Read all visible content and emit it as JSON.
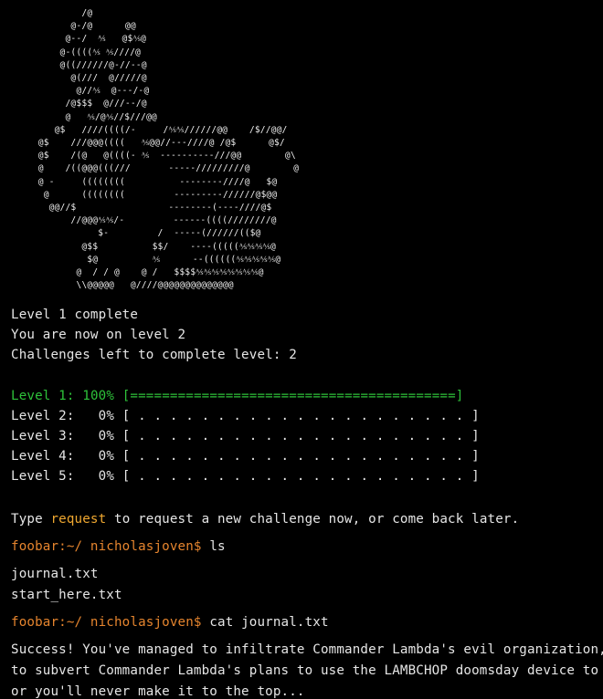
{
  "ascii_art": [
    "          /@",
    "        @-/@      @@",
    "       @--/  ⅍   @$⅍@",
    "      @-((((⅍ ⅍////@",
    "      @((//////@-//--@",
    "        @(///  @/////@",
    "         @//⅍  @---/-@",
    "       /@$$$  @///--/@",
    "       @   ⅍/@⅍//$///@@",
    "     @$   ////((((/-     /⅍⅍//////@@    /$//@@/",
    "  @$    ///@@@((((   ⅍@@//---////@ /@$      @$/",
    "  @$    /(@   @((((- ⅍  ----------///@@        @\\",
    "  @    /((@@@(((///       -----/////////@        @",
    "  @ -     ((((((((          --------////@   $@",
    "   @      ((((((((         ---------//////@$@@",
    "    @@//$                 --------(----////@$",
    "        //@@@⅍⅍/-         ------((((////////@",
    "             $-         /  -----(//////(($@",
    "          @$$          $$/    ----(((((⅍⅍⅍⅍@",
    "           $@          ⅍      --((((((⅍⅍⅍⅍⅍@",
    "         @  / / @    @ /   $$$$⅍⅍⅍⅍⅍⅍⅍⅍@",
    "         \\\\@@@@@   @////@@@@@@@@@@@@@@"
  ],
  "messages": {
    "level_complete": "Level 1 complete",
    "current_level": "You are now on level 2",
    "challenges_left": "Challenges left to complete level: 2"
  },
  "progress": [
    {
      "label": "Level 1:",
      "percent": "100%",
      "bar": "[=========================================]",
      "value": 1.0
    },
    {
      "label": "Level 2:",
      "percent": "0%",
      "bar": "[ . . . . . . . . . . . . . . . . . . . . . ]",
      "value": 0.0
    },
    {
      "label": "Level 3:",
      "percent": "0%",
      "bar": "[ . . . . . . . . . . . . . . . . . . . . . ]",
      "value": 0.0
    },
    {
      "label": "Level 4:",
      "percent": "0%",
      "bar": "[ . . . . . . . . . . . . . . . . . . . . . ]",
      "value": 0.0
    },
    {
      "label": "Level 5:",
      "percent": "0%",
      "bar": "[ . . . . . . . . . . . . . . . . . . . . . ]",
      "value": 0.0
    }
  ],
  "request_prompt": {
    "before": "Type ",
    "keyword": "request",
    "after": " to request a new challenge now, or come back later."
  },
  "commands": [
    {
      "prompt": "foobar:~/ nicholasjoven$",
      "command": "ls"
    },
    {
      "prompt": "foobar:~/ nicholasjoven$",
      "command": "cat journal.txt"
    }
  ],
  "ls_output": [
    "journal.txt",
    "start_here.txt"
  ],
  "journal": [
    "Success! You've managed to infiltrate Commander Lambda's evil organization,",
    "to subvert Commander Lambda's plans to use the LAMBCHOP doomsday device to d",
    "or you'll never make it to the top..."
  ],
  "colors": {
    "background": "#000000",
    "text": "#e6e6e6",
    "success_green": "#2ec23a",
    "prompt_orange": "#e6852e",
    "keyword_orange": "#f0a830"
  }
}
